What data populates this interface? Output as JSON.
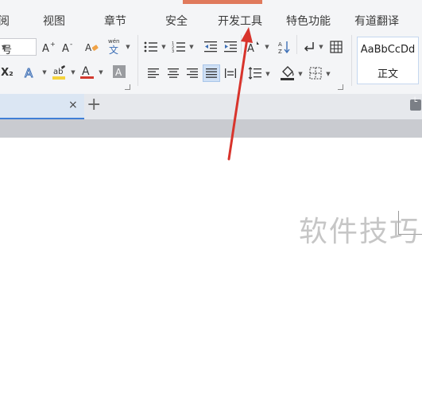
{
  "menu": {
    "tabs": [
      {
        "label": "阅",
        "name": "tab-review"
      },
      {
        "label": "视图",
        "name": "tab-view"
      },
      {
        "label": "章节",
        "name": "tab-chapter"
      },
      {
        "label": "安全",
        "name": "tab-security"
      },
      {
        "label": "开发工具",
        "name": "tab-developer-tools"
      },
      {
        "label": "特色功能",
        "name": "tab-special-features"
      },
      {
        "label": "有道翻译",
        "name": "tab-youdao-translate"
      }
    ],
    "accent_color": "#e07a5c"
  },
  "ribbon": {
    "font_size_value": "号",
    "superscript_label": "X₂",
    "phonetic_top": "wén",
    "phonetic_bottom": "文",
    "style_preview_text": "AaBbCcDd",
    "style_preview_name": "正文",
    "highlight_color": "#f5d33c",
    "font_color": "#d33a2f",
    "active_align_bg": "#cfe0f5"
  },
  "tabstrip": {
    "close_label": "×",
    "new_tab_label": "+"
  },
  "watermark": "软件技巧",
  "annotation": {
    "color": "#d8342c"
  }
}
